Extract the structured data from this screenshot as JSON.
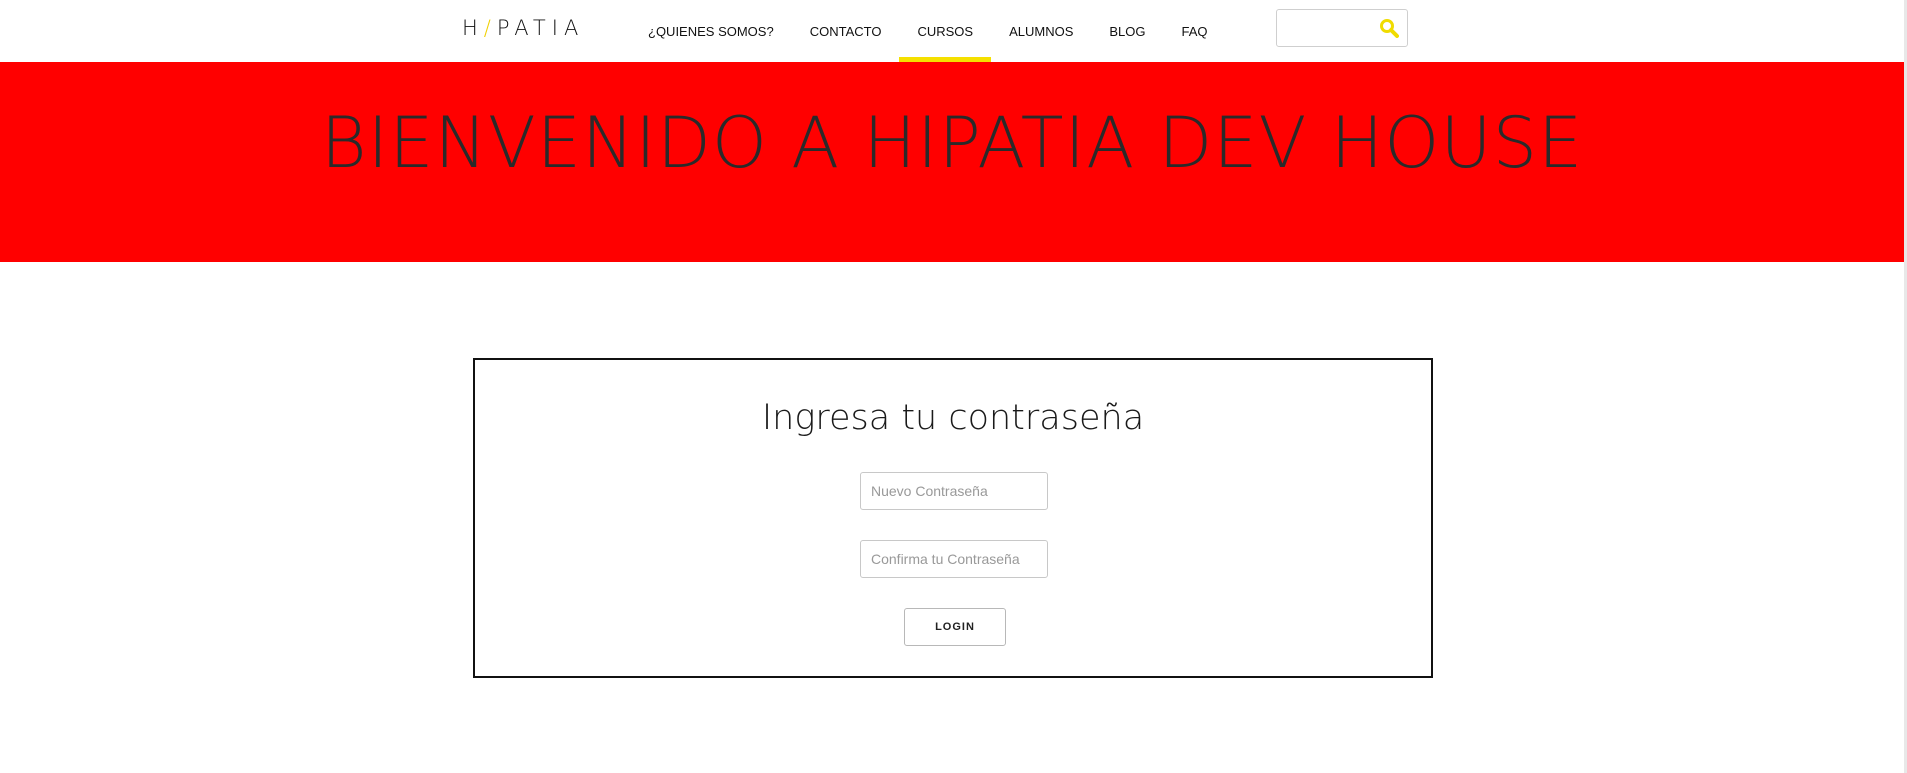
{
  "header": {
    "logo": {
      "left": "H",
      "slash": "/",
      "right": "PATIA"
    },
    "nav": [
      {
        "label": "¿QUIENES SOMOS?",
        "active": false
      },
      {
        "label": "CONTACTO",
        "active": false
      },
      {
        "label": "CURSOS",
        "active": true
      },
      {
        "label": "ALUMNOS",
        "active": false
      },
      {
        "label": "BLOG",
        "active": false
      },
      {
        "label": "FAQ",
        "active": false
      }
    ],
    "search": {
      "value": "",
      "placeholder": "",
      "icon": "search-icon"
    }
  },
  "hero": {
    "title": "BIENVENIDO A HIPATIA DEV HOUSE",
    "background": "#ff0000"
  },
  "login_card": {
    "title": "Ingresa tu contraseña",
    "new_password": {
      "value": "",
      "placeholder": "Nuevo Contraseña"
    },
    "confirm_password": {
      "value": "",
      "placeholder": "Confirma tu Contraseña"
    },
    "submit_label": "LOGIN"
  },
  "colors": {
    "accent": "#f5e000",
    "hero": "#ff0000",
    "text": "#222222"
  }
}
